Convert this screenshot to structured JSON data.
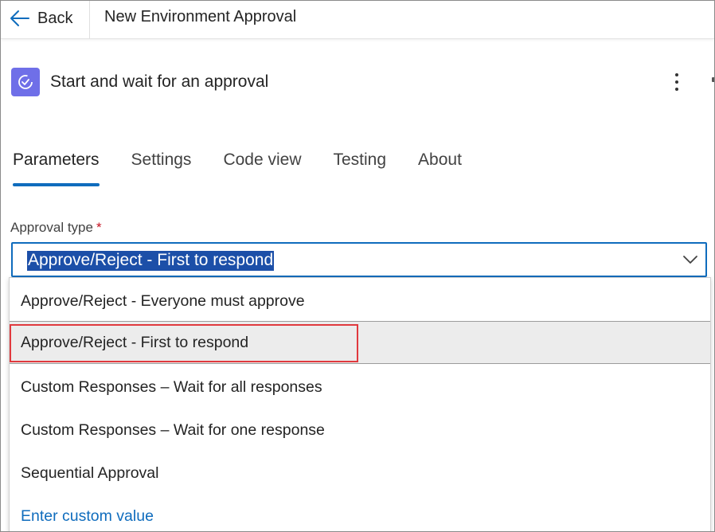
{
  "topbar": {
    "back_label": "Back",
    "flow_title": "New Environment Approval"
  },
  "action": {
    "title": "Start and wait for an approval",
    "icon": "approval-icon",
    "icon_color": "#6f6fe8"
  },
  "tabs": [
    {
      "label": "Parameters",
      "active": true
    },
    {
      "label": "Settings",
      "active": false
    },
    {
      "label": "Code view",
      "active": false
    },
    {
      "label": "Testing",
      "active": false
    },
    {
      "label": "About",
      "active": false
    }
  ],
  "field": {
    "label": "Approval type",
    "required_mark": "*",
    "value": "Approve/Reject - First to respond"
  },
  "dropdown": {
    "options": [
      "Approve/Reject - Everyone must approve",
      "Approve/Reject - First to respond",
      "Custom Responses – Wait for all responses",
      "Custom Responses – Wait for one response",
      "Sequential Approval"
    ],
    "selected_index": 1,
    "custom_value_label": "Enter custom value"
  },
  "colors": {
    "accent": "#0f6cbd",
    "highlight_border": "#e0393e",
    "selection_bg": "#1c4fa8"
  }
}
